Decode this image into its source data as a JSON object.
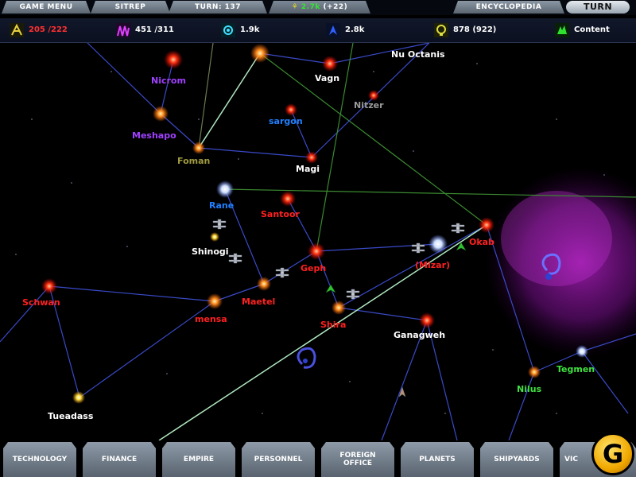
{
  "topbar": {
    "game_menu": "GAME MENU",
    "sitrep": "SITREP",
    "turn": "TURN: 137",
    "ap_value": "2.7k",
    "ap_delta": "(+22)",
    "encyclopedia": "ENCYCLOPEDIA",
    "turn_button": "TURN"
  },
  "resources": {
    "food": "205 /222",
    "industry": "451 /311",
    "research": "1.9k",
    "intel": "2.8k",
    "energy": "878 (922)",
    "morale": "Content"
  },
  "stars": [
    {
      "name": "Nu Octanis",
      "color": "#ffffff"
    },
    {
      "name": "Vagn",
      "color": "#ffffff"
    },
    {
      "name": "Nicrom",
      "color": "#a040ff"
    },
    {
      "name": "Nitzer",
      "color": "#9a9a9a"
    },
    {
      "name": "sargon",
      "color": "#2080ff"
    },
    {
      "name": "Meshapo",
      "color": "#a040ff"
    },
    {
      "name": "Foman",
      "color": "#a09a40"
    },
    {
      "name": "Magi",
      "color": "#ffffff"
    },
    {
      "name": "Rane",
      "color": "#2080ff"
    },
    {
      "name": "Santoor",
      "color": "#ff2020"
    },
    {
      "name": "Shinogi",
      "color": "#ffffff"
    },
    {
      "name": "Geph",
      "color": "#ff2020"
    },
    {
      "name": "(Mizar)",
      "color": "#ff2020"
    },
    {
      "name": "Okab",
      "color": "#ff2020"
    },
    {
      "name": "Schwan",
      "color": "#ff2020"
    },
    {
      "name": "Maetel",
      "color": "#ff2020"
    },
    {
      "name": "mensa",
      "color": "#ff2020"
    },
    {
      "name": "Shira",
      "color": "#ff2020"
    },
    {
      "name": "Ganagweh",
      "color": "#ffffff"
    },
    {
      "name": "Tegmen",
      "color": "#40e040"
    },
    {
      "name": "Nilus",
      "color": "#40e040"
    },
    {
      "name": "Tueadass",
      "color": "#ffffff"
    }
  ],
  "bottom_tabs": [
    "TECHNOLOGY",
    "FINANCE",
    "EMPIRE",
    "PERSONNEL",
    "FOREIGN\nOFFICE",
    "PLANETS",
    "SHIPYARDS",
    "VIC"
  ],
  "logo": "G"
}
